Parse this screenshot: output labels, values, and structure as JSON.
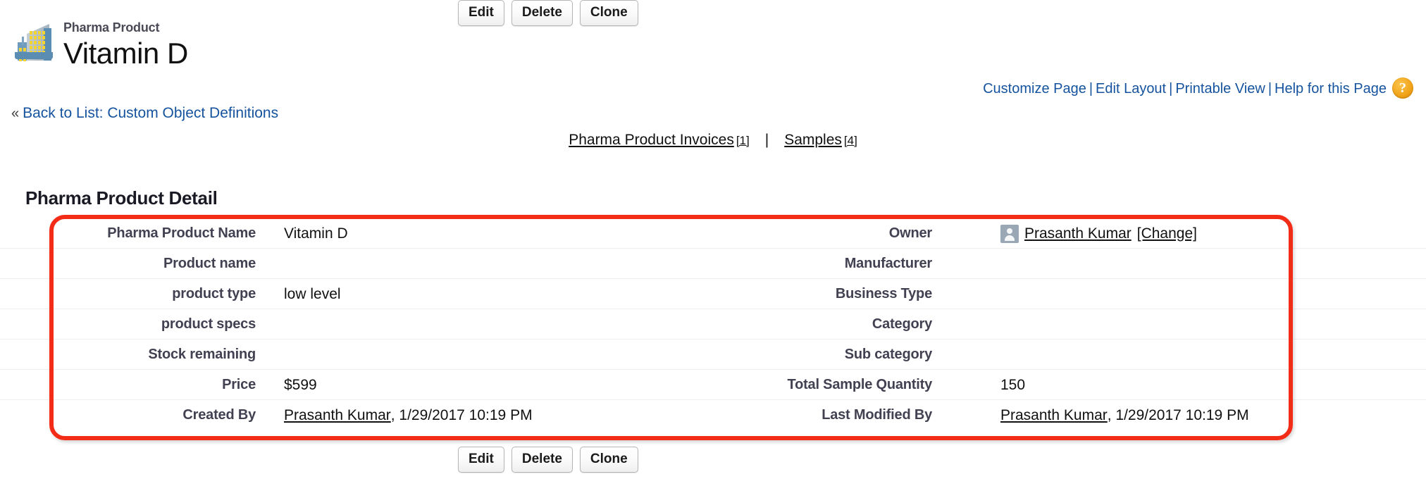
{
  "header": {
    "entity_type": "Pharma Product",
    "record_name": "Vitamin D",
    "entity_icon": "building-icon"
  },
  "utility_links": {
    "customize_page": "Customize Page",
    "edit_layout": "Edit Layout",
    "printable_view": "Printable View",
    "help_for_this_page": "Help for this Page",
    "separator": "|",
    "help_icon_glyph": "?"
  },
  "back_link": {
    "chevron": "«",
    "label": "Back to List: Custom Object Definitions"
  },
  "related_nav": {
    "items": [
      {
        "label": "Pharma Product Invoices",
        "count": "[1]"
      },
      {
        "label": "Samples",
        "count": "[4]"
      }
    ],
    "divider": "|"
  },
  "detail": {
    "section_title": "Pharma Product Detail",
    "buttons": [
      {
        "label": "Edit",
        "name": "edit-button"
      },
      {
        "label": "Delete",
        "name": "delete-button"
      },
      {
        "label": "Clone",
        "name": "clone-button"
      }
    ],
    "rows": [
      {
        "left_label": "Pharma Product Name",
        "left_value": "Vitamin D",
        "right_label": "Owner",
        "right_value": "Prasanth Kumar",
        "right_extra": "[Change]"
      },
      {
        "left_label": "Product name",
        "left_value": "",
        "right_label": "Manufacturer",
        "right_value": ""
      },
      {
        "left_label": "product type",
        "left_value": "low level",
        "right_label": "Business Type",
        "right_value": ""
      },
      {
        "left_label": "product specs",
        "left_value": "",
        "right_label": "Category",
        "right_value": ""
      },
      {
        "left_label": "Stock remaining",
        "left_value": "",
        "right_label": "Sub category",
        "right_value": ""
      },
      {
        "left_label": "Price",
        "left_value": "$599",
        "right_label": "Total Sample Quantity",
        "right_value": "150"
      },
      {
        "left_label": "Created By",
        "left_value_link": "Prasanth Kumar",
        "left_value_rest": ", 1/29/2017 10:19 PM",
        "right_label": "Last Modified By",
        "right_value_link": "Prasanth Kumar",
        "right_value_rest": ", 1/29/2017 10:19 PM"
      }
    ]
  },
  "annotation": {
    "color": "#f32c18",
    "shape": "rounded-rectangle-highlight"
  }
}
